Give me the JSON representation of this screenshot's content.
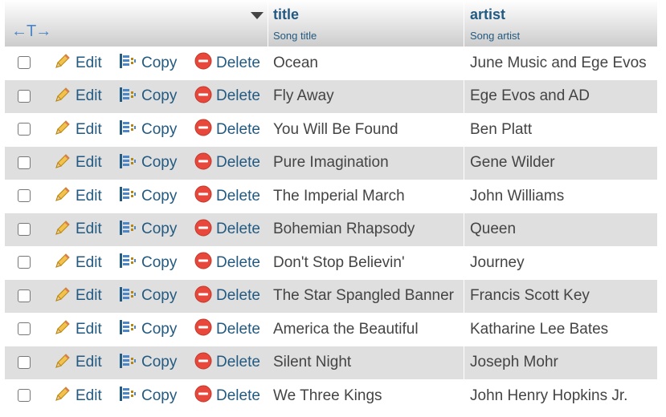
{
  "header": {
    "columns": [
      {
        "name": "title",
        "comment": "Song title"
      },
      {
        "name": "artist",
        "comment": "Song artist"
      }
    ]
  },
  "actions": {
    "edit": "Edit",
    "copy": "Copy",
    "delete": "Delete"
  },
  "rows": [
    {
      "title": "Ocean",
      "artist": "June Music and Ege Evos"
    },
    {
      "title": "Fly Away",
      "artist": "Ege Evos and AD"
    },
    {
      "title": "You Will Be Found",
      "artist": "Ben Platt"
    },
    {
      "title": "Pure Imagination",
      "artist": "Gene Wilder"
    },
    {
      "title": "The Imperial March",
      "artist": "John Williams"
    },
    {
      "title": "Bohemian Rhapsody",
      "artist": "Queen"
    },
    {
      "title": "Don't Stop Believin'",
      "artist": "Journey"
    },
    {
      "title": "The Star Spangled Banner",
      "artist": "Francis Scott Key"
    },
    {
      "title": "America the Beautiful",
      "artist": "Katharine Lee Bates"
    },
    {
      "title": "Silent Night",
      "artist": "Joseph Mohr"
    },
    {
      "title": "We Three Kings",
      "artist": "John Henry Hopkins Jr."
    }
  ],
  "colors": {
    "link": "#235a81",
    "row_alt": "#dfdfdf",
    "text": "#444444",
    "delete_icon": "#e8473c"
  }
}
